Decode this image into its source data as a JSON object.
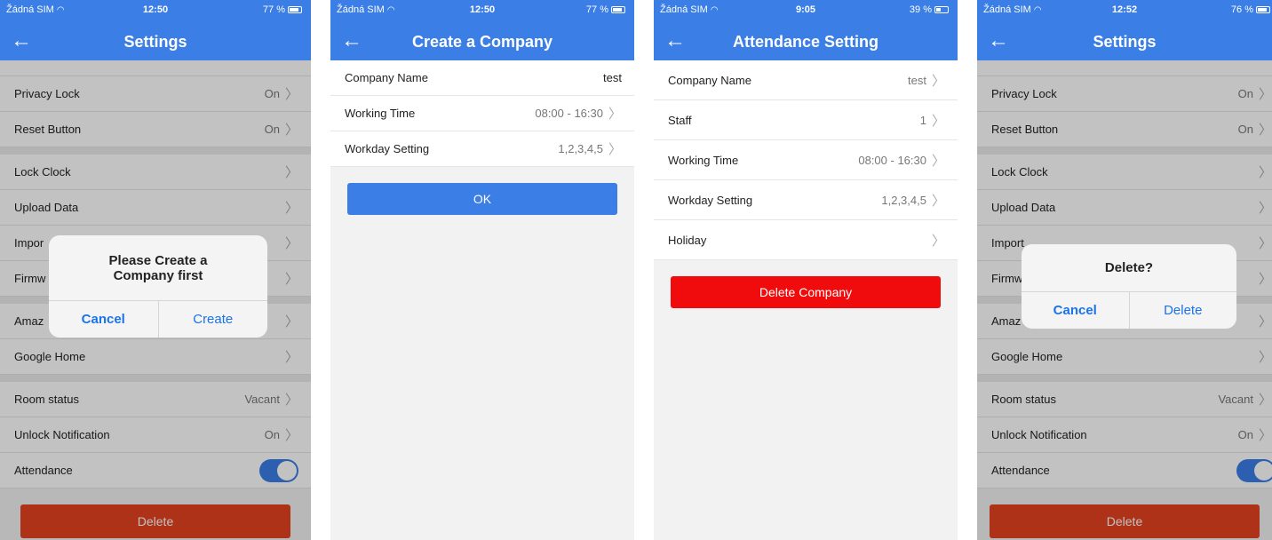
{
  "status": {
    "carrier": "Žádná SIM",
    "s1": {
      "time": "12:50",
      "battery": "77 %"
    },
    "s2": {
      "time": "12:50",
      "battery": "77 %"
    },
    "s3": {
      "time": "9:05",
      "battery": "39 %"
    },
    "s4": {
      "time": "12:52",
      "battery": "76 %"
    }
  },
  "settings": {
    "title": "Settings",
    "privacy_lock": {
      "label": "Privacy Lock",
      "value": "On"
    },
    "reset_button": {
      "label": "Reset Button",
      "value": "On"
    },
    "lock_clock": "Lock Clock",
    "upload_data": "Upload Data",
    "import_label": "Impor",
    "import_label_s4": "Import",
    "firmware_label": "Firmw",
    "amazon_label": "Amaz",
    "amazon_label_s4": "Amaz",
    "google_home": "Google Home",
    "room_status": {
      "label": "Room status",
      "value": "Vacant"
    },
    "unlock_notification": {
      "label": "Unlock Notification",
      "value": "On"
    },
    "attendance": {
      "label": "Attendance",
      "enabled": true
    },
    "delete_button": "Delete"
  },
  "alert_create": {
    "message_line1": "Please Create a",
    "message_line2": "Company first",
    "cancel": "Cancel",
    "create": "Create"
  },
  "alert_delete": {
    "message": "Delete?",
    "cancel": "Cancel",
    "delete": "Delete"
  },
  "create_company": {
    "title": "Create a Company",
    "company_name": {
      "label": "Company Name",
      "value": "test"
    },
    "working_time": {
      "label": "Working Time",
      "value": "08:00 - 16:30"
    },
    "workday_setting": {
      "label": "Workday Setting",
      "value": "1,2,3,4,5"
    },
    "ok_button": "OK"
  },
  "attendance_setting": {
    "title": "Attendance Setting",
    "company_name": {
      "label": "Company Name",
      "value": "test"
    },
    "staff": {
      "label": "Staff",
      "value": "1"
    },
    "working_time": {
      "label": "Working Time",
      "value": "08:00 - 16:30"
    },
    "workday_setting": {
      "label": "Workday Setting",
      "value": "1,2,3,4,5"
    },
    "holiday": {
      "label": "Holiday"
    },
    "delete_button": "Delete Company"
  },
  "colors": {
    "primary": "#3a7ee6",
    "danger": "#e5421f",
    "danger_bright": "#f00c0c",
    "link": "#1b73e8"
  }
}
